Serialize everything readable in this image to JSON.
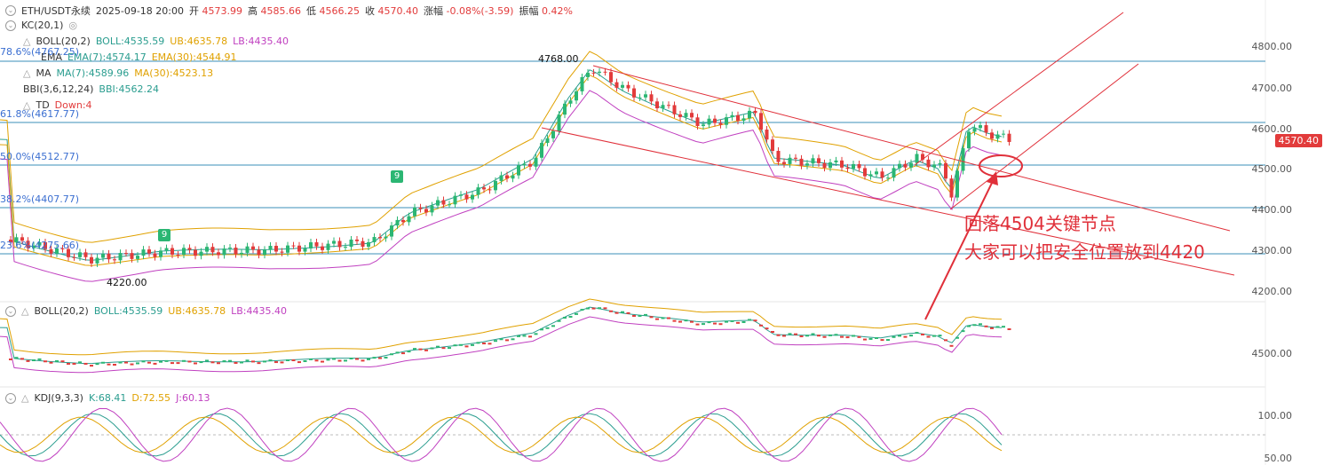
{
  "header": {
    "symbol": "ETH/USDT永续",
    "datetime": "2025-09-18 20:00",
    "open_label": "开",
    "open": "4573.99",
    "high_label": "高",
    "high": "4585.66",
    "low_label": "低",
    "low": "4566.25",
    "close_label": "收",
    "close": "4570.40",
    "change_label": "涨幅",
    "change": "-0.08%(-3.59)",
    "amp_label": "振幅",
    "amp": "0.42%"
  },
  "indicators": {
    "kc": "KC(20,1)",
    "boll_name": "BOLL(20,2)",
    "boll_val": "BOLL:4535.59",
    "boll_ub": "UB:4635.78",
    "boll_lb": "LB:4435.40",
    "ema_name": "EMA",
    "ema7": "EMA(7):4574.17",
    "ema30": "EMA(30):4544.91",
    "ma_name": "MA",
    "ma7": "MA(7):4589.96",
    "ma30": "MA(30):4523.13",
    "bbi_name": "BBI(3,6,12,24)",
    "bbi_val": "BBI:4562.24",
    "td_name": "TD",
    "td_val": "Down:4"
  },
  "fib": {
    "f786": "78.6%(4767.25)",
    "f618": "61.8%(4617.77)",
    "f500": "50.0%(4512.77)",
    "f382": "38.2%(4407.77)",
    "f236": "23.6%(4275.66)"
  },
  "price_axis": [
    "4800.00",
    "4700.00",
    "4600.00",
    "4500.00",
    "4400.00",
    "4300.00",
    "4200.00"
  ],
  "current_price": "4570.40",
  "markers": {
    "high": "4768.00",
    "low": "4220.00"
  },
  "signals": [
    "9",
    "9"
  ],
  "annotation": {
    "line1": "回落4504关键节点",
    "line2": "大家可以把安全位置放到4420"
  },
  "boll_pane": {
    "name": "BOLL(20,2)",
    "boll": "BOLL:4535.59",
    "ub": "UB:4635.78",
    "lb": "LB:4435.40",
    "axis": "4500.00"
  },
  "kdj_pane": {
    "name": "KDJ(9,3,3)",
    "k": "K:68.41",
    "d": "D:72.55",
    "j": "J:60.13",
    "axis_top": "100.00",
    "axis_bottom": "50.00"
  },
  "colors": {
    "up": "#2bb673",
    "down": "#e23b3b",
    "accent": "#e0303a",
    "fib": "#3b6fd1"
  }
}
